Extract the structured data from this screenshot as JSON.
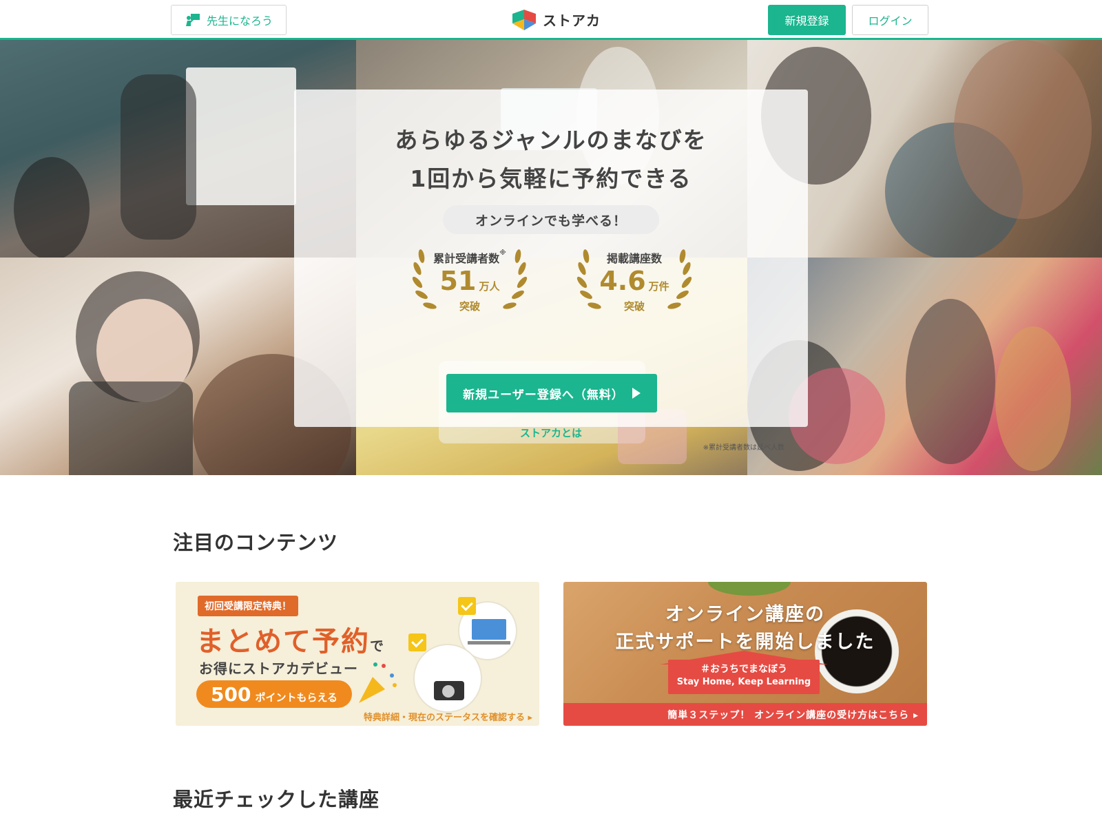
{
  "header": {
    "teacher_label": "先生になろう",
    "logo_text": "ストアカ",
    "signup_label": "新規登録",
    "login_label": "ログイン"
  },
  "hero": {
    "title_line1": "あらゆるジャンルのまなびを",
    "title_line2": "1回から気軽に予約できる",
    "online_pill": "オンラインでも学べる！",
    "stats": [
      {
        "label": "累計受講者数",
        "number": "51",
        "unit": "万人",
        "sub": "突破"
      },
      {
        "label": "掲載講座数",
        "number": "4.6",
        "unit": "万件",
        "sub": "突破"
      }
    ],
    "asterisk": "※",
    "cta_label": "新規ユーザー登録へ（無料）",
    "about_link": "ストアカとは",
    "note": "※累計受講者数は延べ人数"
  },
  "featured": {
    "title": "注目のコンテンツ",
    "banner1": {
      "tag": "初回受講限定特典！",
      "main": "まとめて予約",
      "main_suffix": "で",
      "sub": "お得にストアカデビュー",
      "points_number": "500",
      "points_text": "ポイントもらえる",
      "link": "特典詳細・現在のステータスを確認する ▸"
    },
    "banner2": {
      "title_line1": "オンライン講座の",
      "title_line2": "正式サポートを開始しました",
      "hashtag": "＃おうちでまなぼう",
      "stay": "Stay Home, Keep Learning",
      "bar": "簡単３ステップ！ オンライン講座の受け方はこちら ▸"
    }
  },
  "recent": {
    "title": "最近チェックした講座"
  },
  "colors": {
    "accent": "#1bb58f",
    "gold": "#b08a2e",
    "orange": "#e0602a",
    "red": "#e54b43"
  }
}
